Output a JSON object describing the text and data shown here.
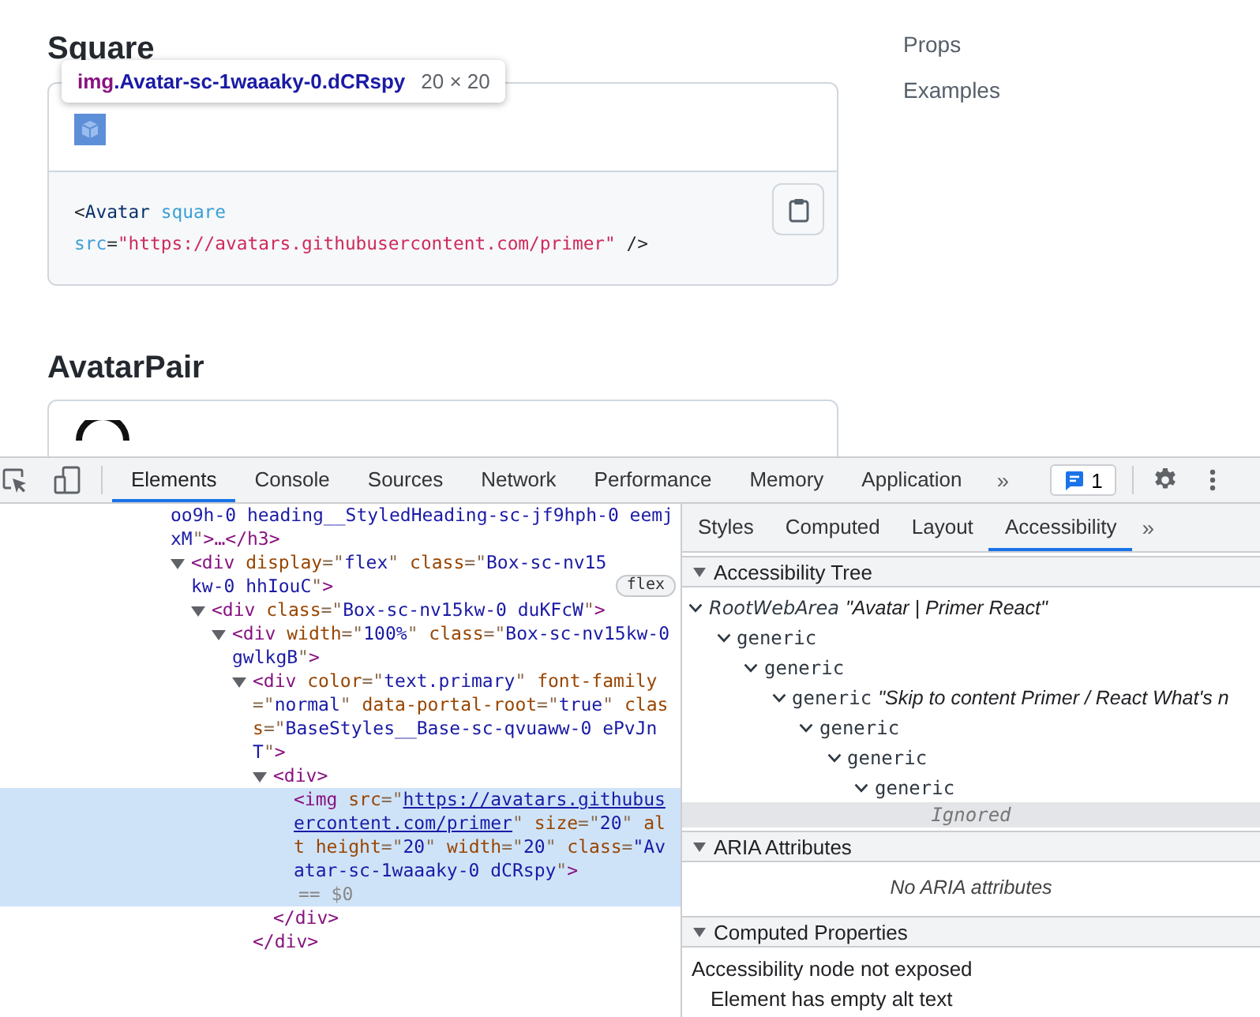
{
  "page": {
    "square": {
      "heading": "Square",
      "tooltip": {
        "tag": "img",
        "selector": ".Avatar-sc-1waaaky-0.dCRspy",
        "size": "20 × 20"
      },
      "code": [
        [
          {
            "kind": "punct",
            "text": "<"
          },
          {
            "kind": "tag",
            "text": "Avatar"
          },
          {
            "kind": "attr",
            "text": " square"
          }
        ],
        [
          {
            "kind": "attr",
            "text": "src"
          },
          {
            "kind": "punct",
            "text": "="
          },
          {
            "kind": "string",
            "text": "\"https://avatars.githubusercontent.com/primer\""
          },
          {
            "kind": "punct",
            "text": " />"
          }
        ]
      ]
    },
    "avatar_pair": {
      "heading": "AvatarPair"
    },
    "toc": [
      "Props",
      "Examples"
    ]
  },
  "devtools": {
    "tabs": [
      {
        "label": "Elements",
        "selected": true
      },
      {
        "label": "Console",
        "selected": false
      },
      {
        "label": "Sources",
        "selected": false
      },
      {
        "label": "Network",
        "selected": false
      },
      {
        "label": "Performance",
        "selected": false
      },
      {
        "label": "Memory",
        "selected": false
      },
      {
        "label": "Application",
        "selected": false
      }
    ],
    "more_tabs": "»",
    "issues_count": "1",
    "dom": [
      {
        "kind": "continuation",
        "tokens": [
          {
            "kind": "value",
            "text": "oo9h-0 heading__StyledHeading-sc-jf9hph-0 eemjxM"
          },
          {
            "kind": "punct",
            "text": "\""
          },
          {
            "kind": "tag",
            "text": ">…</h3>"
          }
        ]
      },
      {
        "kind": "element",
        "selected": false,
        "expanded": true,
        "badge": "flex",
        "tokens": [
          {
            "kind": "tag",
            "text": "<div"
          },
          {
            "kind": "attr",
            "text": " display"
          },
          {
            "kind": "punct",
            "text": "=\""
          },
          {
            "kind": "value",
            "text": "flex"
          },
          {
            "kind": "punct",
            "text": "\""
          },
          {
            "kind": "attr",
            "text": " class"
          },
          {
            "kind": "punct",
            "text": "=\""
          },
          {
            "kind": "value",
            "text": "Box-sc-nv15kw-0 hhIouC"
          },
          {
            "kind": "punct",
            "text": "\""
          },
          {
            "kind": "tag",
            "text": ">"
          }
        ],
        "children": [
          {
            "kind": "element",
            "selected": false,
            "expanded": true,
            "tokens": [
              {
                "kind": "tag",
                "text": "<div"
              },
              {
                "kind": "attr",
                "text": " class"
              },
              {
                "kind": "punct",
                "text": "=\""
              },
              {
                "kind": "value",
                "text": "Box-sc-nv15kw-0 duKFcW"
              },
              {
                "kind": "punct",
                "text": "\""
              },
              {
                "kind": "tag",
                "text": ">"
              }
            ],
            "children": [
              {
                "kind": "element",
                "selected": false,
                "expanded": true,
                "tokens": [
                  {
                    "kind": "tag",
                    "text": "<div"
                  },
                  {
                    "kind": "attr",
                    "text": " width"
                  },
                  {
                    "kind": "punct",
                    "text": "=\""
                  },
                  {
                    "kind": "value",
                    "text": "100%"
                  },
                  {
                    "kind": "punct",
                    "text": "\""
                  },
                  {
                    "kind": "attr",
                    "text": " class"
                  },
                  {
                    "kind": "punct",
                    "text": "=\""
                  },
                  {
                    "kind": "value",
                    "text": "Box-sc-nv15kw-0 gwlkgB"
                  },
                  {
                    "kind": "punct",
                    "text": "\""
                  },
                  {
                    "kind": "tag",
                    "text": ">"
                  }
                ],
                "children": [
                  {
                    "kind": "element",
                    "selected": false,
                    "expanded": true,
                    "closing": "</div>",
                    "tokens": [
                      {
                        "kind": "tag",
                        "text": "<div"
                      },
                      {
                        "kind": "attr",
                        "text": " color"
                      },
                      {
                        "kind": "punct",
                        "text": "=\""
                      },
                      {
                        "kind": "value",
                        "text": "text.primary"
                      },
                      {
                        "kind": "punct",
                        "text": "\""
                      },
                      {
                        "kind": "attr",
                        "text": " font-family"
                      },
                      {
                        "kind": "punct",
                        "text": "=\""
                      },
                      {
                        "kind": "value",
                        "text": "normal"
                      },
                      {
                        "kind": "punct",
                        "text": "\""
                      },
                      {
                        "kind": "attr",
                        "text": " data-portal-root"
                      },
                      {
                        "kind": "punct",
                        "text": "=\""
                      },
                      {
                        "kind": "value",
                        "text": "true"
                      },
                      {
                        "kind": "punct",
                        "text": "\""
                      },
                      {
                        "kind": "attr",
                        "text": " class"
                      },
                      {
                        "kind": "punct",
                        "text": "=\""
                      },
                      {
                        "kind": "value",
                        "text": "BaseStyles__Base-sc-qvuaww-0 ePvJnT"
                      },
                      {
                        "kind": "punct",
                        "text": "\""
                      },
                      {
                        "kind": "tag",
                        "text": ">"
                      }
                    ],
                    "children": [
                      {
                        "kind": "element",
                        "selected": false,
                        "expanded": true,
                        "closing": "</div>",
                        "tokens": [
                          {
                            "kind": "tag",
                            "text": "<div>"
                          }
                        ],
                        "children": [
                          {
                            "kind": "element",
                            "selected": true,
                            "console_ref": "== $0",
                            "tokens": [
                              {
                                "kind": "tag",
                                "text": "<img"
                              },
                              {
                                "kind": "attr",
                                "text": " src"
                              },
                              {
                                "kind": "punct",
                                "text": "=\""
                              },
                              {
                                "kind": "link",
                                "text": "https://avatars.githubusercontent.com/primer"
                              },
                              {
                                "kind": "punct",
                                "text": "\""
                              },
                              {
                                "kind": "attr",
                                "text": " size"
                              },
                              {
                                "kind": "punct",
                                "text": "=\""
                              },
                              {
                                "kind": "value",
                                "text": "20"
                              },
                              {
                                "kind": "punct",
                                "text": "\""
                              },
                              {
                                "kind": "attr",
                                "text": " alt height"
                              },
                              {
                                "kind": "punct",
                                "text": "=\""
                              },
                              {
                                "kind": "value",
                                "text": "20"
                              },
                              {
                                "kind": "punct",
                                "text": "\""
                              },
                              {
                                "kind": "attr",
                                "text": " width"
                              },
                              {
                                "kind": "punct",
                                "text": "=\""
                              },
                              {
                                "kind": "value",
                                "text": "20"
                              },
                              {
                                "kind": "punct",
                                "text": "\""
                              },
                              {
                                "kind": "attr",
                                "text": " class"
                              },
                              {
                                "kind": "punct",
                                "text": "="
                              },
                              {
                                "kind": "value",
                                "text": "\"Avatar-sc-1waaaky-0 dCRspy"
                              },
                              {
                                "kind": "punct",
                                "text": "\""
                              },
                              {
                                "kind": "tag",
                                "text": ">"
                              }
                            ]
                          }
                        ]
                      }
                    ]
                  }
                ]
              }
            ]
          }
        ]
      }
    ],
    "side_tabs": [
      {
        "label": "Styles",
        "selected": false
      },
      {
        "label": "Computed",
        "selected": false
      },
      {
        "label": "Layout",
        "selected": false
      },
      {
        "label": "Accessibility",
        "selected": true
      }
    ],
    "side_more": "»",
    "sections": [
      {
        "kind": "tree",
        "title": "Accessibility Tree",
        "expanded": true,
        "tree": [
          {
            "kind": "node",
            "role": "RootWebArea",
            "name": "\"Avatar | Primer React\"",
            "expanded": true,
            "children": [
              {
                "kind": "node",
                "role": "generic",
                "expanded": true,
                "children": [
                  {
                    "kind": "node",
                    "role": "generic",
                    "expanded": true,
                    "children": [
                      {
                        "kind": "node",
                        "role": "generic",
                        "name": "\"Skip to content Primer / React What's n",
                        "expanded": true,
                        "children": [
                          {
                            "kind": "node",
                            "role": "generic",
                            "expanded": true,
                            "children": [
                              {
                                "kind": "node",
                                "role": "generic",
                                "expanded": true,
                                "children": [
                                  {
                                    "kind": "node",
                                    "role": "generic",
                                    "expanded": true,
                                    "children": [
                                      {
                                        "kind": "ignored",
                                        "role": "Ignored"
                                      }
                                    ]
                                  }
                                ]
                              }
                            ]
                          }
                        ]
                      }
                    ]
                  }
                ]
              }
            ]
          }
        ]
      },
      {
        "kind": "message",
        "title": "ARIA Attributes",
        "expanded": true,
        "message": "No ARIA attributes"
      },
      {
        "kind": "properties",
        "title": "Computed Properties",
        "expanded": true,
        "lines": [
          {
            "text": "Accessibility node not exposed",
            "children": [
              {
                "text": "Element has empty alt text"
              }
            ]
          }
        ]
      }
    ]
  }
}
